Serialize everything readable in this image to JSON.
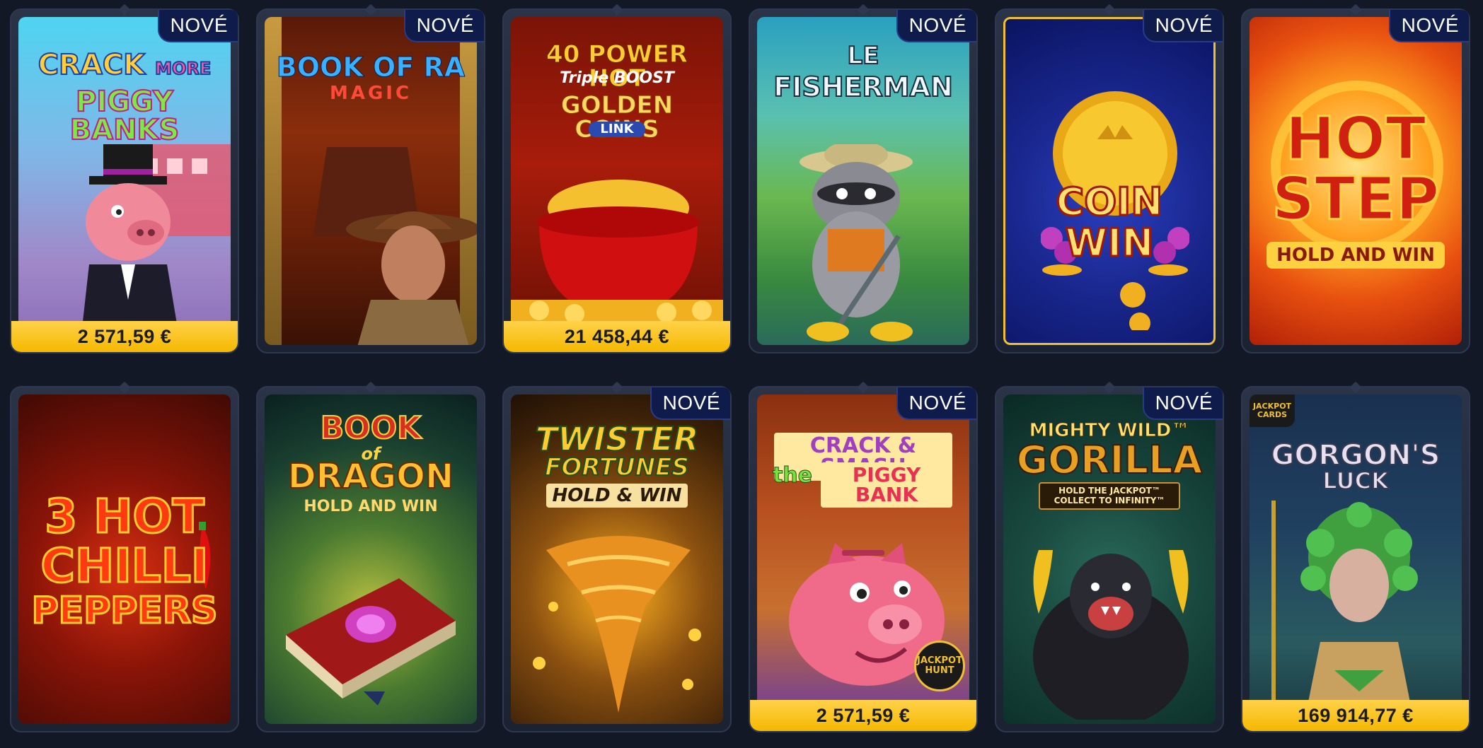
{
  "badge_label": "NOVÉ",
  "colors": {
    "background": "#121826",
    "badge_bg": "#0f1b4a",
    "jackpot_bar": "#f5b800"
  },
  "games": [
    {
      "title_line1": "CRACK",
      "title_line2": "MORE",
      "title_line3": "PIGGY BANKS",
      "jackpot": "2 571,59 €",
      "badge": true
    },
    {
      "title_line1": "BOOK OF RA",
      "title_line2": "MAGIC",
      "badge": true
    },
    {
      "title_line1": "40 POWER HOT",
      "title_line2": "Triple BOOST",
      "title_line3": "GOLDEN COINS",
      "title_line4": "LINK",
      "jackpot": "21 458,44 €"
    },
    {
      "title_line1": "LE",
      "title_line2": "FISHERMAN",
      "badge": true
    },
    {
      "title_line1": "COIN",
      "title_line2": "WIN",
      "badge": true
    },
    {
      "title_line1": "HOT",
      "title_line2": "STEP",
      "title_line3": "HOLD AND WIN",
      "badge": true
    },
    {
      "title_line1": "3 HOT",
      "title_line2": "CHILLI",
      "title_line3": "PEPPERS"
    },
    {
      "title_line1": "BOOK",
      "title_line2": "of",
      "title_line3": "DRAGON",
      "title_line4": "HOLD AND WIN"
    },
    {
      "title_line1": "TWISTER",
      "title_line2": "FORTUNES",
      "title_line3": "HOLD & WIN",
      "badge": true
    },
    {
      "title_line1": "CRACK & SMASH",
      "title_line2": "the",
      "title_line3": "PIGGY BANK",
      "title_line4": "JACKPOT HUNT",
      "jackpot": "2 571,59 €",
      "badge": true
    },
    {
      "title_line1": "MIGHTY WILD™",
      "title_line2": "GORILLA",
      "title_line3": "HOLD THE JACKPOT™ COLLECT TO INFINITY™",
      "badge": true
    },
    {
      "title_line1": "JACKPOT CARDS",
      "title_line2": "GORGON'S",
      "title_line3": "LUCK",
      "jackpot": "169 914,77 €"
    }
  ]
}
